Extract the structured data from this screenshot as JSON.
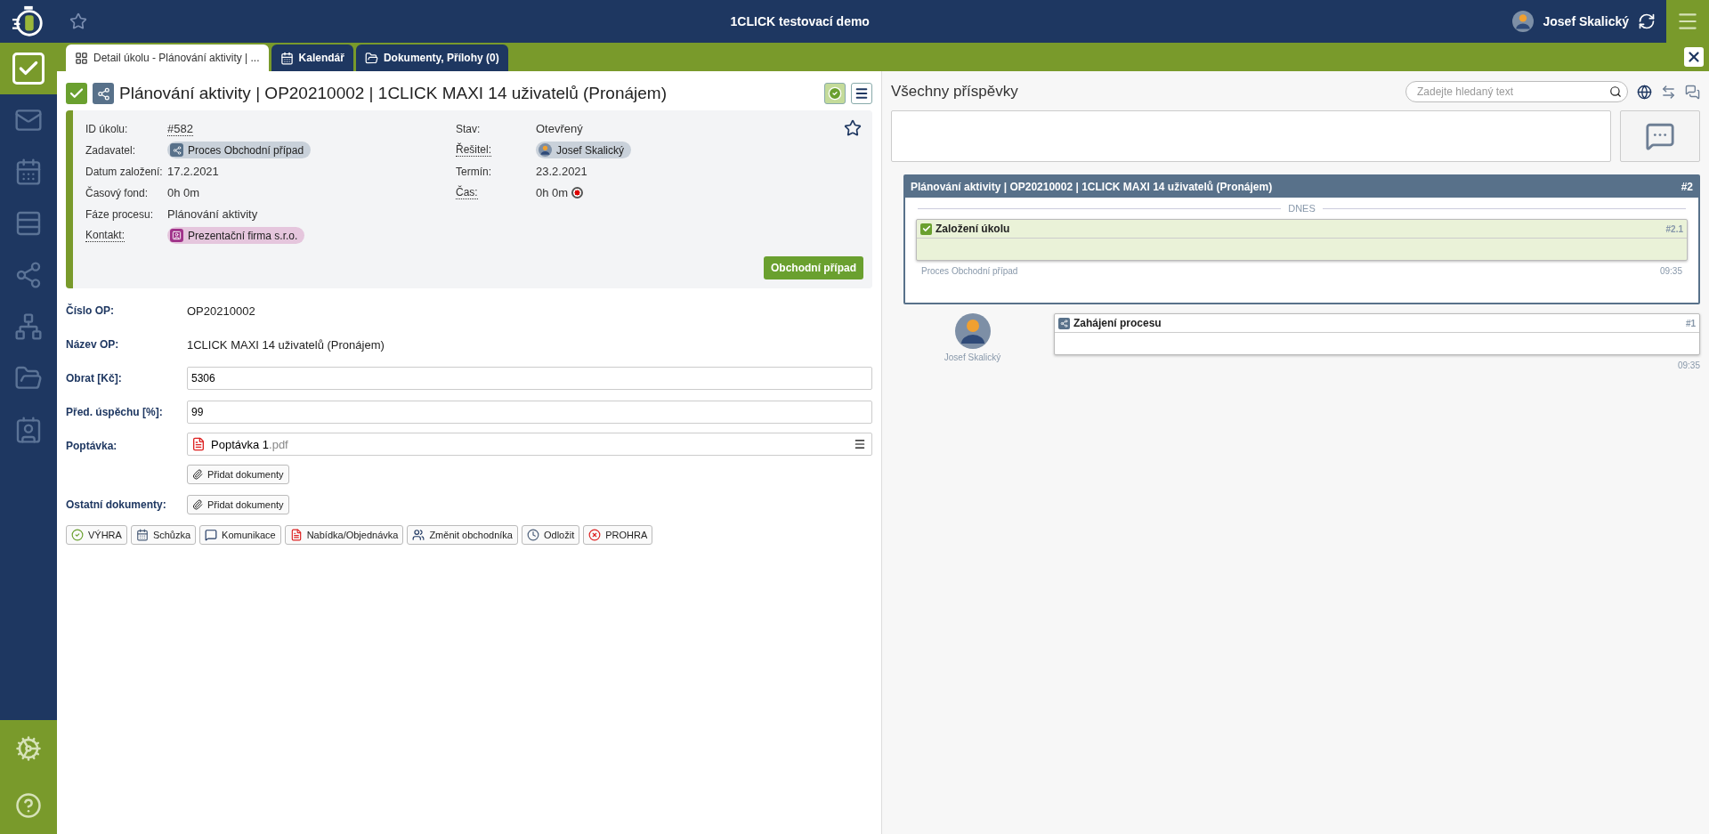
{
  "topbar": {
    "title": "1CLICK testovací demo",
    "user": "Josef Skalický"
  },
  "tabs": [
    {
      "label": "Detail úkolu - Plánování aktivity | ...",
      "selected": true
    },
    {
      "label": "Kalendář",
      "selected": false
    },
    {
      "label": "Dokumenty, Přílohy (0)",
      "selected": false
    }
  ],
  "sidebar": {
    "items": [
      {
        "selected": true
      },
      {
        "selected": false
      },
      {
        "selected": false
      },
      {
        "selected": false
      },
      {
        "selected": false
      },
      {
        "selected": false
      },
      {
        "selected": false
      },
      {
        "selected": false
      }
    ]
  },
  "task": {
    "title": "Plánování aktivity | OP20210002 | 1CLICK MAXI 14 uživatelů (Pronájem)",
    "done": true,
    "fields_left": [
      {
        "label": "ID úkolu:",
        "value": "#582",
        "kind": "link",
        "dotted": false
      },
      {
        "label": "Zadavatel:",
        "value": "Proces Obchodní případ",
        "kind": "process",
        "dotted": false
      },
      {
        "label": "Datum založení:",
        "value": "17.2.2021",
        "kind": "text",
        "dotted": false
      },
      {
        "label": "Časový fond:",
        "value": "0h 0m",
        "kind": "text",
        "dotted": false
      },
      {
        "label": "Fáze procesu:",
        "value": "Plánování aktivity",
        "kind": "text",
        "dotted": false
      },
      {
        "label": "Kontakt:",
        "value": "Prezentační firma s.r.o.",
        "kind": "contact",
        "dotted": true
      }
    ],
    "fields_right": [
      {
        "label": "Stav:",
        "value": "Otevřený",
        "kind": "text",
        "dotted": false
      },
      {
        "label": "Řešitel:",
        "value": "Josef Skalický",
        "kind": "person",
        "dotted": true
      },
      {
        "label": "Termín:",
        "value": "23.2.2021",
        "kind": "text",
        "dotted": false
      },
      {
        "label": "Čas:",
        "value": "0h 0m",
        "kind": "timer",
        "dotted": true
      }
    ],
    "case_button": "Obchodní případ"
  },
  "form": [
    {
      "label": "Číslo OP:",
      "kind": "text",
      "value": "OP20210002"
    },
    {
      "label": "Název OP:",
      "kind": "text",
      "value": "1CLICK MAXI 14 uživatelů (Pronájem)"
    },
    {
      "label": "Obrat [Kč]:",
      "kind": "input",
      "value": "5306"
    },
    {
      "label": "Před. úspěchu [%]:",
      "kind": "input",
      "value": "99"
    },
    {
      "label": "Poptávka:",
      "kind": "files",
      "file": "Poptávka 1",
      "ext": ".pdf",
      "button": "Přidat dokumenty"
    },
    {
      "label": "Ostatní dokumenty:",
      "kind": "add",
      "button": "Přidat dokumenty"
    }
  ],
  "actions": [
    {
      "label": "VÝHRA",
      "kind": "win"
    },
    {
      "label": "Schůzka",
      "kind": "meeting"
    },
    {
      "label": "Komunikace",
      "kind": "comm"
    },
    {
      "label": "Nabídka/Objednávka",
      "kind": "offer"
    },
    {
      "label": "Změnit obchodníka",
      "kind": "change"
    },
    {
      "label": "Odložit",
      "kind": "postpone"
    },
    {
      "label": "PROHRA",
      "kind": "lose"
    }
  ],
  "feed": {
    "title": "Všechny příspěvky",
    "search": {
      "placeholder": "Zadejte hledaný text"
    },
    "thread": {
      "title": "Plánování aktivity | OP20210002 | 1CLICK MAXI 14 uživatelů (Pronájem)",
      "number": "#2",
      "divider": "DNES",
      "post": {
        "title": "Založení úkolu",
        "number": "#2.1",
        "source": "Proces Obchodní případ",
        "time": "09:35"
      }
    },
    "posts": [
      {
        "author": "Josef Skalický",
        "title": "Zahájení procesu",
        "number": "#1",
        "time": "09:35"
      }
    ]
  }
}
